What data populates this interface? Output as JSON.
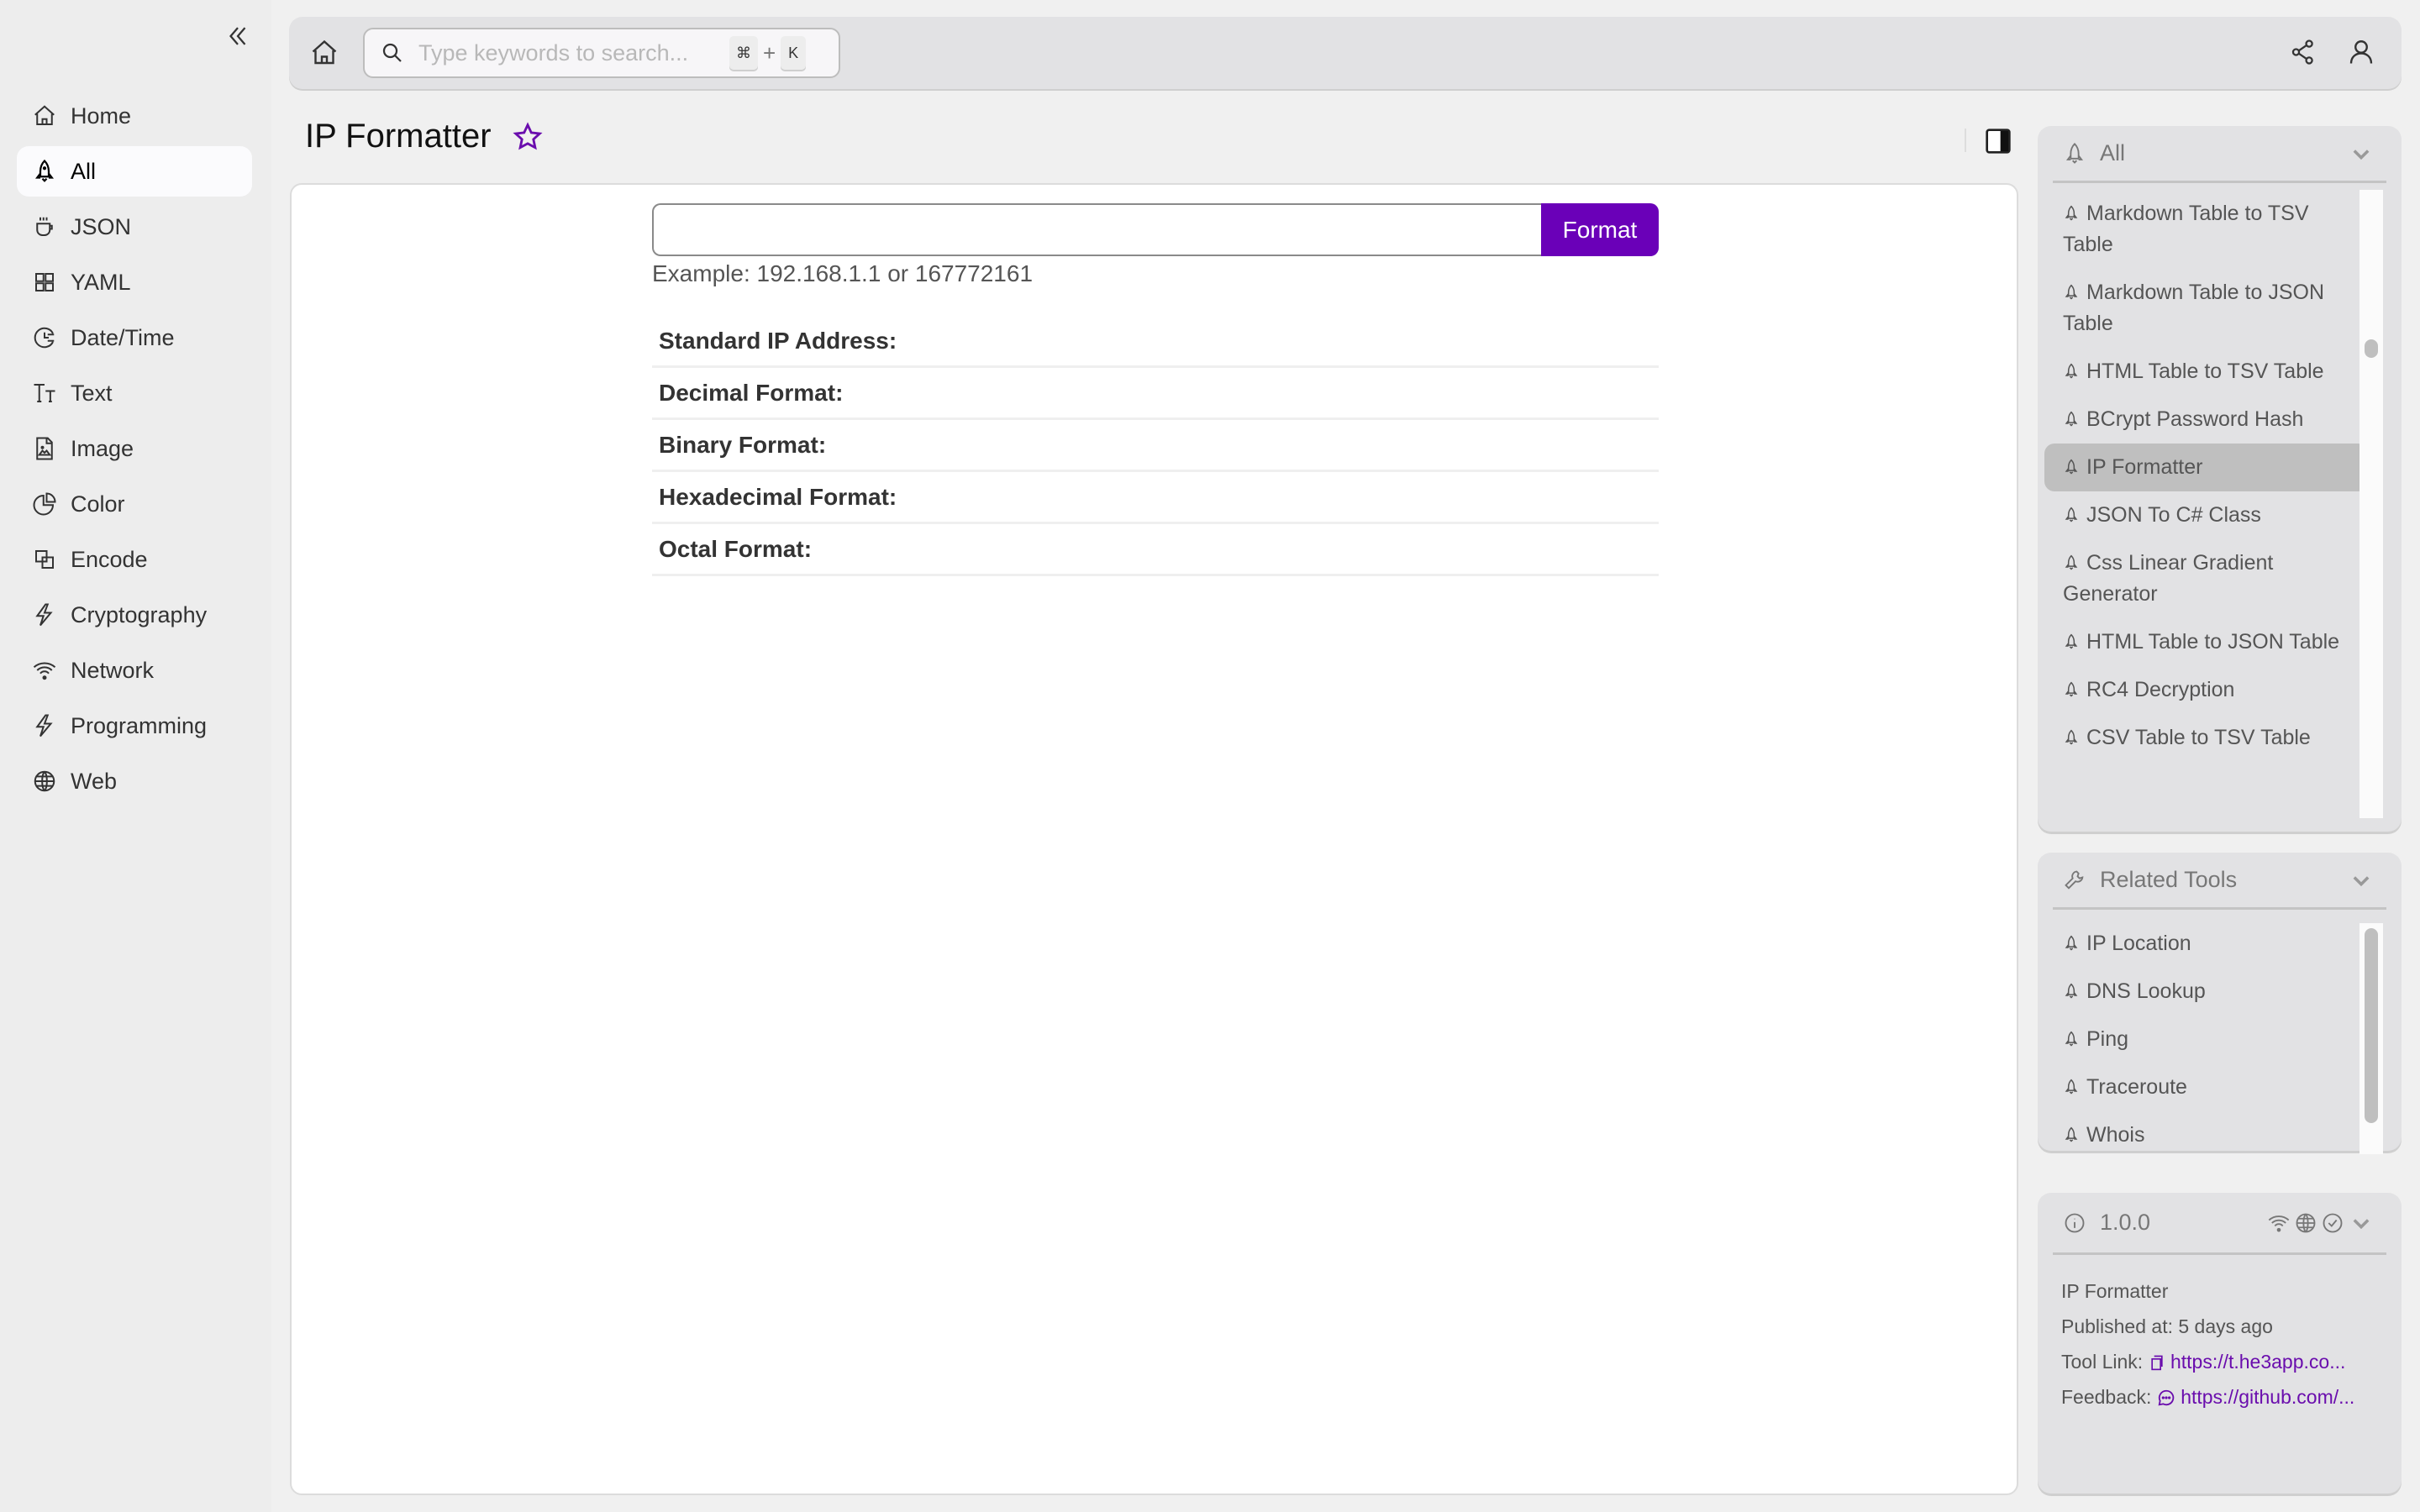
{
  "sidebar": {
    "collapse_icon": "double-chevron-left-icon",
    "items": [
      {
        "label": "Home",
        "icon": "home-icon",
        "active": false
      },
      {
        "label": "All",
        "icon": "rocket-icon",
        "active": true
      },
      {
        "label": "JSON",
        "icon": "cup-icon",
        "active": false
      },
      {
        "label": "YAML",
        "icon": "grid-icon",
        "active": false
      },
      {
        "label": "Date/Time",
        "icon": "clock-icon",
        "active": false
      },
      {
        "label": "Text",
        "icon": "text-size-icon",
        "active": false
      },
      {
        "label": "Image",
        "icon": "image-file-icon",
        "active": false
      },
      {
        "label": "Color",
        "icon": "pie-icon",
        "active": false
      },
      {
        "label": "Encode",
        "icon": "squares-icon",
        "active": false
      },
      {
        "label": "Cryptography",
        "icon": "bolt-icon",
        "active": false
      },
      {
        "label": "Network",
        "icon": "wifi-icon",
        "active": false
      },
      {
        "label": "Programming",
        "icon": "bolt-icon",
        "active": false
      },
      {
        "label": "Web",
        "icon": "globe-icon",
        "active": false
      }
    ]
  },
  "topbar": {
    "search_placeholder": "Type keywords to search...",
    "shortcut_mod": "⌘",
    "shortcut_plus": "+",
    "shortcut_key": "K"
  },
  "page": {
    "title": "IP Formatter",
    "favorite": false
  },
  "tool": {
    "input_value": "",
    "format_button": "Format",
    "example": "Example: 192.168.1.1 or 167772161",
    "results": [
      {
        "label": "Standard IP Address:",
        "value": ""
      },
      {
        "label": "Decimal Format:",
        "value": ""
      },
      {
        "label": "Binary Format:",
        "value": ""
      },
      {
        "label": "Hexadecimal Format:",
        "value": ""
      },
      {
        "label": "Octal Format:",
        "value": ""
      }
    ]
  },
  "all_panel": {
    "title": "All",
    "items": [
      {
        "label": "Markdown Table to TSV Table",
        "selected": false
      },
      {
        "label": "Markdown Table to JSON Table",
        "selected": false
      },
      {
        "label": "HTML Table to TSV Table",
        "selected": false
      },
      {
        "label": "BCrypt Password Hash",
        "selected": false
      },
      {
        "label": "IP Formatter",
        "selected": true
      },
      {
        "label": "JSON To C# Class",
        "selected": false
      },
      {
        "label": "Css Linear Gradient Generator",
        "selected": false
      },
      {
        "label": "HTML Table to JSON Table",
        "selected": false
      },
      {
        "label": "RC4 Decryption",
        "selected": false
      },
      {
        "label": "CSV Table to TSV Table",
        "selected": false
      }
    ]
  },
  "related_panel": {
    "title": "Related Tools",
    "items": [
      {
        "label": "IP Location"
      },
      {
        "label": "DNS Lookup"
      },
      {
        "label": "Ping"
      },
      {
        "label": "Traceroute"
      },
      {
        "label": "Whois"
      }
    ]
  },
  "info_panel": {
    "version": "1.0.0",
    "name": "IP Formatter",
    "published": "Published at: 5 days ago",
    "tool_link_label": "Tool Link:",
    "tool_link": "https://t.he3app.co...",
    "feedback_label": "Feedback:",
    "feedback_link": "https://github.com/..."
  },
  "colors": {
    "accent": "#6a00b8",
    "sidebar_bg": "#ededed",
    "panel_bg": "#e2e2e4",
    "selected_bg": "#bfbfbf"
  }
}
